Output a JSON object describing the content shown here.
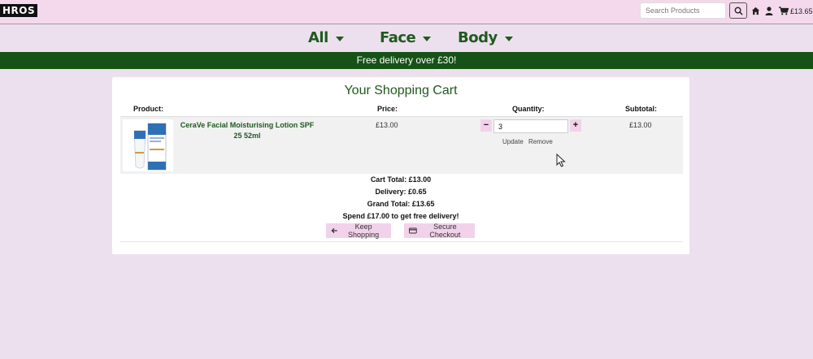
{
  "header": {
    "logo_text": "HROS",
    "search_placeholder": "Search Products",
    "cart_total": "£13.65"
  },
  "nav": {
    "categories": [
      {
        "label": "All"
      },
      {
        "label": "Face"
      },
      {
        "label": "Body"
      }
    ]
  },
  "banner": {
    "text": "Free delivery over £30!"
  },
  "cart": {
    "title": "Your Shopping Cart",
    "columns": {
      "product": "Product:",
      "price": "Price:",
      "quantity": "Quantity:",
      "subtotal": "Subtotal:"
    },
    "items": [
      {
        "name": "CeraVe Facial Moisturising Lotion SPF 25 52ml",
        "price": "£13.00",
        "quantity": "3",
        "subtotal": "£13.00",
        "update_label": "Update",
        "remove_label": "Remove",
        "minus_label": "−",
        "plus_label": "+"
      }
    ],
    "totals": {
      "cart_total": "Cart Total: £13.00",
      "delivery": "Delivery: £0.65",
      "grand_total": "Grand Total: £13.65",
      "free_delivery_note": "Spend £17.00 to get free delivery!"
    },
    "buttons": {
      "keep_shopping": "Keep Shopping",
      "secure_checkout": "Secure Checkout"
    }
  },
  "colors": {
    "header_bg": "#f4d9ec",
    "page_bg": "#ede0ee",
    "brand_green": "#165216",
    "button_pink": "#f2d2ea"
  },
  "icons": [
    "search-icon",
    "home-icon",
    "user-icon",
    "cart-icon",
    "arrow-left-icon",
    "credit-card-icon",
    "mouse-cursor-icon"
  ]
}
